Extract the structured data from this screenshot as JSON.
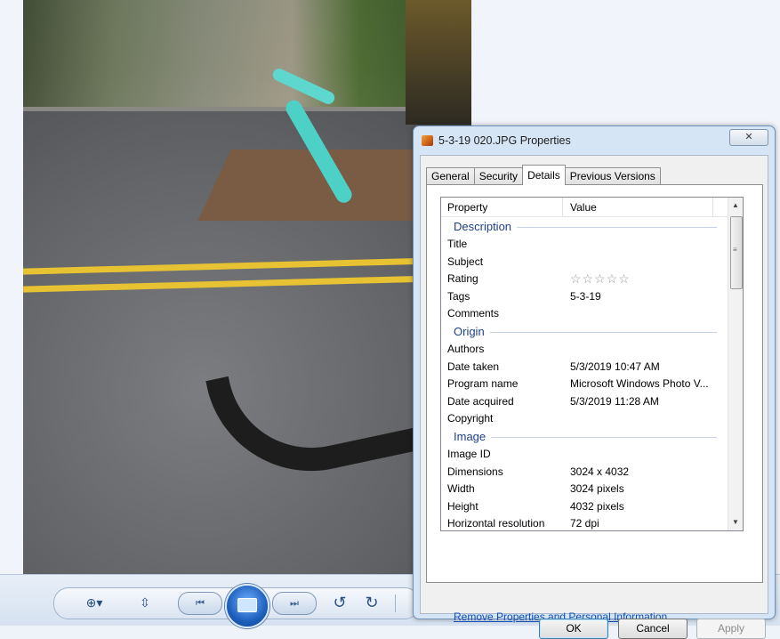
{
  "dialog": {
    "title": "5-3-19 020.JPG Properties",
    "close_glyph": "✕",
    "tabs": [
      "General",
      "Security",
      "Details",
      "Previous Versions"
    ],
    "active_tab": "Details",
    "columns": {
      "property": "Property",
      "value": "Value"
    },
    "groups": {
      "description": {
        "label": "Description",
        "rows": [
          {
            "key": "Title",
            "value": ""
          },
          {
            "key": "Subject",
            "value": ""
          },
          {
            "key": "Rating",
            "value": ""
          },
          {
            "key": "Tags",
            "value": "5-3-19"
          },
          {
            "key": "Comments",
            "value": ""
          }
        ]
      },
      "origin": {
        "label": "Origin",
        "rows": [
          {
            "key": "Authors",
            "value": ""
          },
          {
            "key": "Date taken",
            "value": "5/3/2019 10:47 AM"
          },
          {
            "key": "Program name",
            "value": "Microsoft Windows Photo V..."
          },
          {
            "key": "Date acquired",
            "value": "5/3/2019 11:28 AM"
          },
          {
            "key": "Copyright",
            "value": ""
          }
        ]
      },
      "image": {
        "label": "Image",
        "rows": [
          {
            "key": "Image ID",
            "value": ""
          },
          {
            "key": "Dimensions",
            "value": "3024 x 4032"
          },
          {
            "key": "Width",
            "value": "3024 pixels"
          },
          {
            "key": "Height",
            "value": "4032 pixels"
          },
          {
            "key": "Horizontal resolution",
            "value": "72 dpi"
          }
        ]
      }
    },
    "rating_stars": "☆☆☆☆☆",
    "remove_link": "Remove Properties and Personal Information",
    "buttons": {
      "ok": "OK",
      "cancel": "Cancel",
      "apply": "Apply"
    }
  },
  "viewer_toolbar": {
    "zoom_glyph": "⊕▾",
    "fit_glyph": "⇳",
    "prev_glyph": "⏮",
    "next_glyph": "⏭",
    "rotate_ccw_glyph": "↺",
    "rotate_cw_glyph": "↻"
  },
  "colors": {
    "link": "#0f4fb5",
    "group_header": "#1e3f8a",
    "dialog_frame": "#d6e5f5"
  }
}
